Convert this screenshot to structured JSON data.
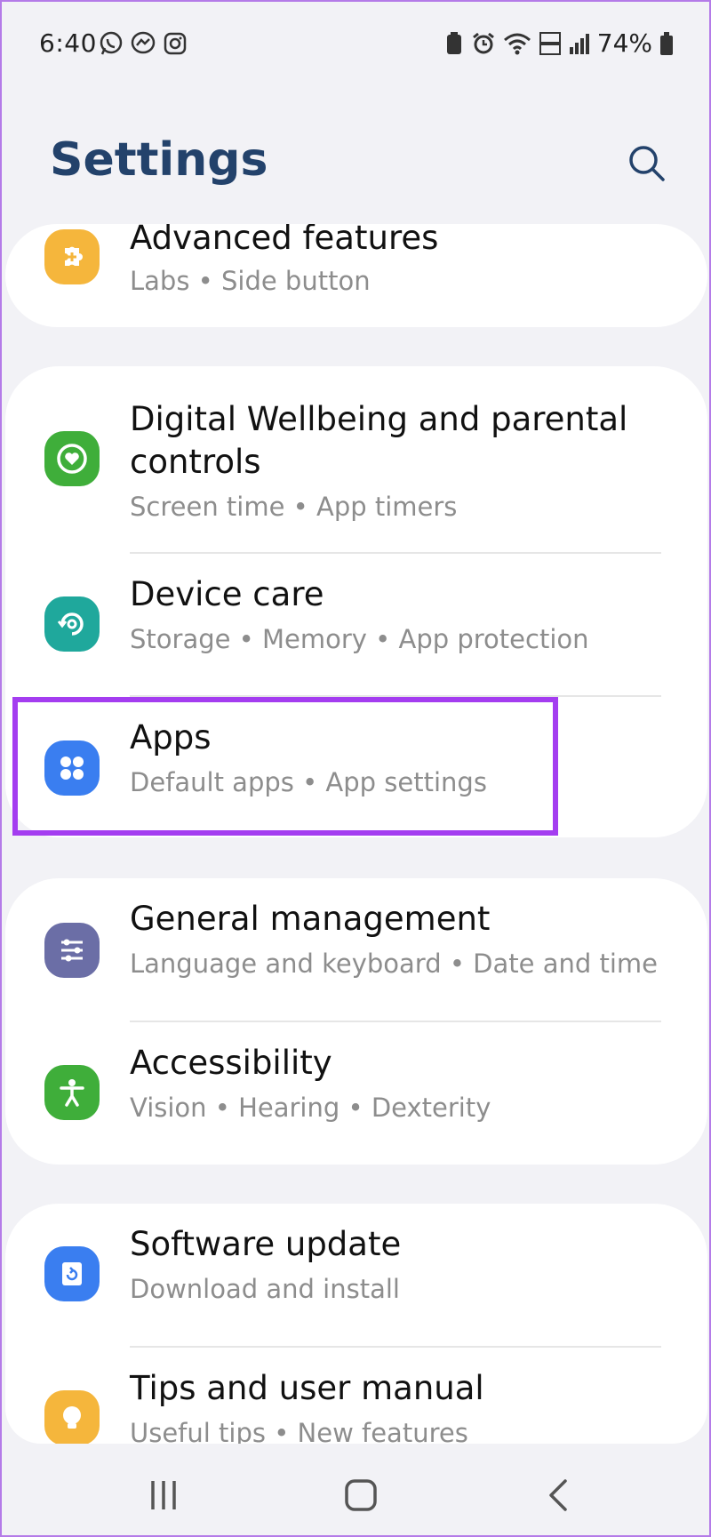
{
  "status_bar": {
    "time": "6:40",
    "battery": "74%"
  },
  "header": {
    "title": "Settings"
  },
  "settings": {
    "advanced": {
      "title": "Advanced features",
      "subtitle": "Labs  •  Side button",
      "color": "#f5b63c",
      "icon": "puzzle-icon"
    },
    "wellbeing": {
      "title_line1": "Digital Wellbeing and parental",
      "title_line2": "controls",
      "subtitle": "Screen time  •  App timers",
      "color": "#3fae3a",
      "icon": "heart-circle-icon"
    },
    "device_care": {
      "title": "Device care",
      "subtitle": "Storage  •  Memory  •  App protection",
      "color": "#1fa89c",
      "icon": "refresh-circle-icon"
    },
    "apps": {
      "title": "Apps",
      "subtitle": "Default apps  •  App settings",
      "color": "#3a7ef0",
      "icon": "four-dots-icon"
    },
    "general": {
      "title": "General management",
      "subtitle": "Language and keyboard  •  Date and time",
      "color": "#6b6ea6",
      "icon": "sliders-icon"
    },
    "accessibility": {
      "title": "Accessibility",
      "subtitle": "Vision  •  Hearing  •  Dexterity",
      "color": "#3fae3a",
      "icon": "person-icon"
    },
    "software_update": {
      "title": "Software update",
      "subtitle": "Download and install",
      "color": "#3a7ef0",
      "icon": "update-icon"
    },
    "tips": {
      "title": "Tips and user manual",
      "subtitle": "Useful tips  •  New features",
      "color": "#f5b63c",
      "icon": "lightbulb-icon"
    }
  },
  "highlight_color": "#a43df0"
}
